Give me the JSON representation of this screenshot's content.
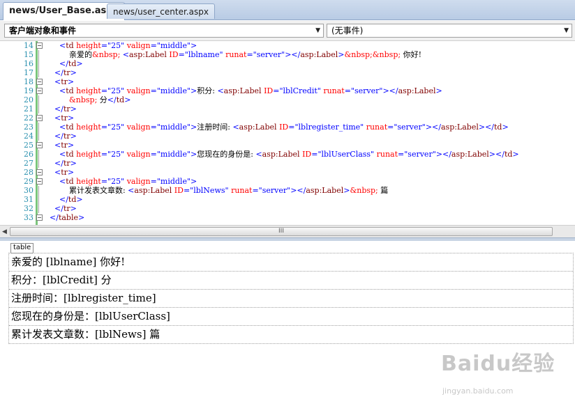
{
  "tabs": [
    {
      "label": "news/User_Base.aspx",
      "active": true
    },
    {
      "label": "news/user_center.aspx",
      "active": false
    }
  ],
  "dropdowns": {
    "object": "客户端对象和事件",
    "event": "(无事件)"
  },
  "code_lines": [
    {
      "num": "14",
      "fold": "minus",
      "html": "      <span class='b'>&lt;</span><span class='t'>td</span> <span class='a'>height</span><span class='b'>=\"25\"</span> <span class='a'>valign</span><span class='b'>=\"middle\"&gt;</span>"
    },
    {
      "num": "15",
      "html": "          亲爱的<span class='a'>&amp;nbsp;</span> <span class='b'>&lt;</span><span class='t'>asp:Label</span> <span class='a'>ID</span><span class='b'>=\"lblname\"</span> <span class='a'>runat</span><span class='b'>=\"server\"&gt;&lt;/</span><span class='t'>asp:Label</span><span class='b'>&gt;</span><span class='a'>&amp;nbsp;&amp;nbsp;</span> 你好!"
    },
    {
      "num": "16",
      "html": "      <span class='b'>&lt;/</span><span class='t'>td</span><span class='b'>&gt;</span>"
    },
    {
      "num": "17",
      "html": "    <span class='b'>&lt;/</span><span class='t'>tr</span><span class='b'>&gt;</span>"
    },
    {
      "num": "18",
      "fold": "minus",
      "html": "    <span class='b'>&lt;</span><span class='t'>tr</span><span class='b'>&gt;</span>"
    },
    {
      "num": "19",
      "fold": "minus",
      "html": "      <span class='b'>&lt;</span><span class='t'>td</span> <span class='a'>height</span><span class='b'>=\"25\"</span> <span class='a'>valign</span><span class='b'>=\"middle\"&gt;</span>积分: <span class='b'>&lt;</span><span class='t'>asp:Label</span> <span class='a'>ID</span><span class='b'>=\"lblCredit\"</span> <span class='a'>runat</span><span class='b'>=\"server\"&gt;&lt;/</span><span class='t'>asp:Label</span><span class='b'>&gt;</span>"
    },
    {
      "num": "20",
      "html": "          <span class='a'>&amp;nbsp;</span> 分<span class='b'>&lt;/</span><span class='t'>td</span><span class='b'>&gt;</span>"
    },
    {
      "num": "21",
      "html": "    <span class='b'>&lt;/</span><span class='t'>tr</span><span class='b'>&gt;</span>"
    },
    {
      "num": "22",
      "fold": "minus",
      "html": "    <span class='b'>&lt;</span><span class='t'>tr</span><span class='b'>&gt;</span>"
    },
    {
      "num": "23",
      "html": "      <span class='b'>&lt;</span><span class='t'>td</span> <span class='a'>height</span><span class='b'>=\"25\"</span> <span class='a'>valign</span><span class='b'>=\"middle\"&gt;</span>注册时间: <span class='b'>&lt;</span><span class='t'>asp:Label</span> <span class='a'>ID</span><span class='b'>=\"lblregister_time\"</span> <span class='a'>runat</span><span class='b'>=\"server\"&gt;&lt;/</span><span class='t'>asp:Label</span><span class='b'>&gt;&lt;/</span><span class='t'>td</span><span class='b'>&gt;</span>"
    },
    {
      "num": "24",
      "html": "    <span class='b'>&lt;/</span><span class='t'>tr</span><span class='b'>&gt;</span>"
    },
    {
      "num": "25",
      "fold": "minus",
      "html": "    <span class='b'>&lt;</span><span class='t'>tr</span><span class='b'>&gt;</span>"
    },
    {
      "num": "26",
      "html": "      <span class='b'>&lt;</span><span class='t'>td</span> <span class='a'>height</span><span class='b'>=\"25\"</span> <span class='a'>valign</span><span class='b'>=\"middle\"&gt;</span>您现在的身份是: <span class='b'>&lt;</span><span class='t'>asp:Label</span> <span class='a'>ID</span><span class='b'>=\"lblUserClass\"</span> <span class='a'>runat</span><span class='b'>=\"server\"&gt;&lt;/</span><span class='t'>asp:Label</span><span class='b'>&gt;&lt;/</span><span class='t'>td</span><span class='b'>&gt;</span>"
    },
    {
      "num": "27",
      "html": "    <span class='b'>&lt;/</span><span class='t'>tr</span><span class='b'>&gt;</span>"
    },
    {
      "num": "28",
      "fold": "minus",
      "html": "    <span class='b'>&lt;</span><span class='t'>tr</span><span class='b'>&gt;</span>"
    },
    {
      "num": "29",
      "fold": "minus",
      "html": "      <span class='b'>&lt;</span><span class='t'>td</span> <span class='a'>height</span><span class='b'>=\"25\"</span> <span class='a'>valign</span><span class='b'>=\"middle\"&gt;</span>"
    },
    {
      "num": "30",
      "html": "          累计发表文章数: <span class='b'>&lt;</span><span class='t'>asp:Label</span> <span class='a'>ID</span><span class='b'>=\"lblNews\"</span> <span class='a'>runat</span><span class='b'>=\"server\"&gt;&lt;/</span><span class='t'>asp:Label</span><span class='b'>&gt;</span><span class='a'>&amp;nbsp;</span> 篇"
    },
    {
      "num": "31",
      "html": "      <span class='b'>&lt;/</span><span class='t'>td</span><span class='b'>&gt;</span>"
    },
    {
      "num": "32",
      "html": "    <span class='b'>&lt;/</span><span class='t'>tr</span><span class='b'>&gt;</span>"
    },
    {
      "num": "33",
      "fold": "minus",
      "html": "  <span class='b'>&lt;/</span><span class='t'>table</span><span class='b'>&gt;</span>"
    }
  ],
  "scrollbar": {
    "grip": "III"
  },
  "design": {
    "tag_label": "table",
    "rows": [
      {
        "text": "亲爱的 [lblname] 你好!"
      },
      {
        "text": "积分：[lblCredit] 分"
      },
      {
        "text": "注册时间：[lblregister_time]"
      },
      {
        "text": "您现在的身份是：[lblUserClass]"
      },
      {
        "text": "累计发表文章数：[lblNews] 篇"
      }
    ]
  },
  "watermark": {
    "big": "Baidu经验",
    "small": "jingyan.baidu.com"
  },
  "colors": {
    "tag": "#800000",
    "attr": "#ff0000",
    "value": "#0000ff",
    "linenum": "#2b91af"
  }
}
